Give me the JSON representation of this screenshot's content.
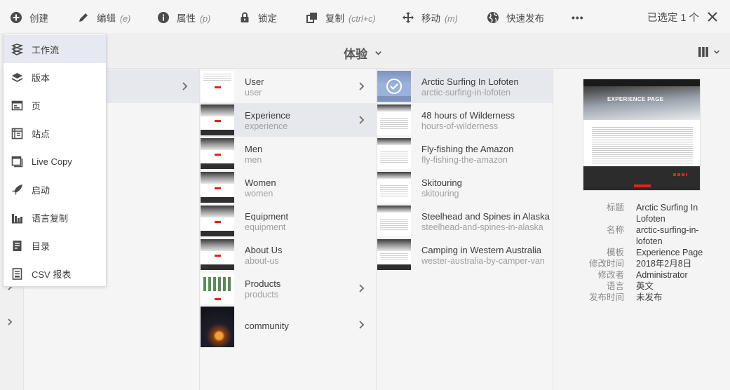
{
  "actionbar": {
    "create": "创建",
    "edit": "编辑",
    "edit_shortcut": "(e)",
    "properties": "属性",
    "properties_shortcut": "(p)",
    "lock": "锁定",
    "copy": "复制",
    "copy_shortcut": "(ctrl+c)",
    "move": "移动",
    "move_shortcut": "(m)",
    "quick_publish": "快速发布",
    "more": "•••",
    "selected_count": "已选定 1 个"
  },
  "title": "体验",
  "create_menu": [
    {
      "label": "工作流",
      "icon": "workflow-icon"
    },
    {
      "label": "版本",
      "icon": "layers-icon"
    },
    {
      "label": "页",
      "icon": "page-icon"
    },
    {
      "label": "站点",
      "icon": "site-icon"
    },
    {
      "label": "Live Copy",
      "icon": "live-copy-icon"
    },
    {
      "label": "启动",
      "icon": "launch-icon"
    },
    {
      "label": "语言复制",
      "icon": "language-copy-icon"
    },
    {
      "label": "目录",
      "icon": "catalog-icon"
    },
    {
      "label": "CSV 报表",
      "icon": "csv-report-icon"
    }
  ],
  "column2": [
    {
      "title": "User",
      "name": "user"
    },
    {
      "title": "Experience",
      "name": "experience"
    },
    {
      "title": "Men",
      "name": "men"
    },
    {
      "title": "Women",
      "name": "women"
    },
    {
      "title": "Equipment",
      "name": "equipment"
    },
    {
      "title": "About Us",
      "name": "about-us"
    },
    {
      "title": "Products",
      "name": "products"
    },
    {
      "title": "community",
      "name": ""
    }
  ],
  "column3": [
    {
      "title": "Arctic Surfing In Lofoten",
      "name": "arctic-surfing-in-lofoten"
    },
    {
      "title": "48 hours of Wilderness",
      "name": "hours-of-wilderness"
    },
    {
      "title": "Fly-fishing the Amazon",
      "name": "fly-fishing-the-amazon"
    },
    {
      "title": "Skitouring",
      "name": "skitouring"
    },
    {
      "title": "Steelhead and Spines in Alaska",
      "name": "steelhead-and-spines-in-alaska"
    },
    {
      "title": "Camping in Western Australia",
      "name": "wester-australia-by-camper-van"
    }
  ],
  "preview": {
    "heading": "EXPERIENCE PAGE"
  },
  "details": {
    "title_label": "标题",
    "title_value": "Arctic Surfing In Lofoten",
    "name_label": "名称",
    "name_value": "arctic-surfing-in-lofoten",
    "template_label": "模板",
    "template_value": "Experience Page",
    "modified_label": "修改时间",
    "modified_value": "2018年2月8日",
    "modifier_label": "修改者",
    "modifier_value": "Administrator",
    "language_label": "语言",
    "language_value": "英文",
    "published_label": "发布时间",
    "published_value": "未发布"
  },
  "colors": {
    "accent_red": "#e1251b",
    "selection": "#e6e8ee",
    "check_overlay": "#8aa3d2"
  }
}
